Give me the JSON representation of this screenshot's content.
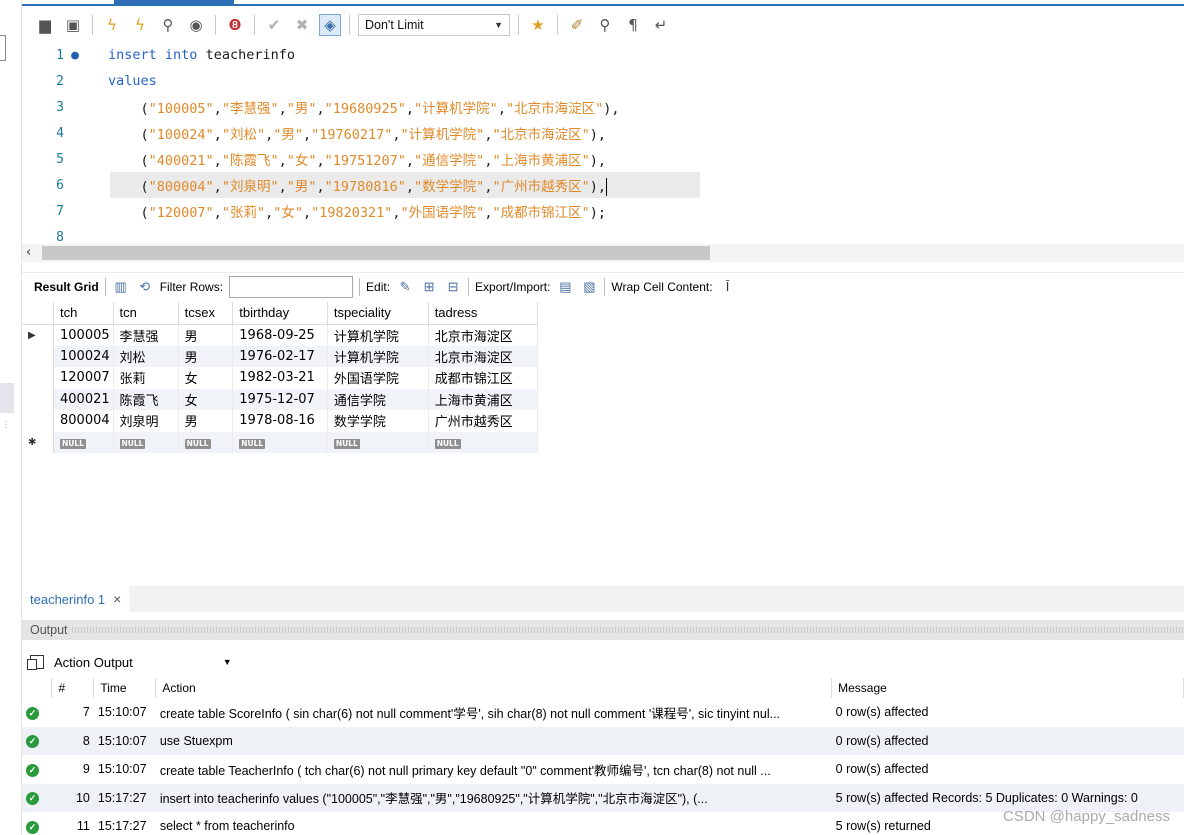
{
  "toolbar": {
    "limit_value": "Don't Limit"
  },
  "editor": {
    "lines": [
      {
        "num": "1",
        "parts": [
          [
            "kw",
            "insert"
          ],
          [
            "ident",
            " "
          ],
          [
            "kw",
            "into"
          ],
          [
            "ident",
            " teacherinfo"
          ]
        ]
      },
      {
        "num": "2",
        "parts": [
          [
            "kw",
            "values"
          ]
        ]
      },
      {
        "num": "3",
        "parts": [
          [
            "ident",
            "    ("
          ],
          [
            "str",
            "\"100005\""
          ],
          [
            "punc",
            ","
          ],
          [
            "str",
            "\"李慧强\""
          ],
          [
            "punc",
            ","
          ],
          [
            "str",
            "\"男\""
          ],
          [
            "punc",
            ","
          ],
          [
            "str",
            "\"19680925\""
          ],
          [
            "punc",
            ","
          ],
          [
            "str",
            "\"计算机学院\""
          ],
          [
            "punc",
            ","
          ],
          [
            "str",
            "\"北京市海淀区\""
          ],
          [
            "punc",
            "),"
          ]
        ]
      },
      {
        "num": "4",
        "parts": [
          [
            "ident",
            "    ("
          ],
          [
            "str",
            "\"100024\""
          ],
          [
            "punc",
            ","
          ],
          [
            "str",
            "\"刘松\""
          ],
          [
            "punc",
            ","
          ],
          [
            "str",
            "\"男\""
          ],
          [
            "punc",
            ","
          ],
          [
            "str",
            "\"19760217\""
          ],
          [
            "punc",
            ","
          ],
          [
            "str",
            "\"计算机学院\""
          ],
          [
            "punc",
            ","
          ],
          [
            "str",
            "\"北京市海淀区\""
          ],
          [
            "punc",
            "),"
          ]
        ]
      },
      {
        "num": "5",
        "parts": [
          [
            "ident",
            "    ("
          ],
          [
            "str",
            "\"400021\""
          ],
          [
            "punc",
            ","
          ],
          [
            "str",
            "\"陈霞飞\""
          ],
          [
            "punc",
            ","
          ],
          [
            "str",
            "\"女\""
          ],
          [
            "punc",
            ","
          ],
          [
            "str",
            "\"19751207\""
          ],
          [
            "punc",
            ","
          ],
          [
            "str",
            "\"通信学院\""
          ],
          [
            "punc",
            ","
          ],
          [
            "str",
            "\"上海市黄浦区\""
          ],
          [
            "punc",
            "),"
          ]
        ]
      },
      {
        "num": "6",
        "parts": [
          [
            "ident",
            "    ("
          ],
          [
            "str",
            "\"800004\""
          ],
          [
            "punc",
            ","
          ],
          [
            "str",
            "\"刘泉明\""
          ],
          [
            "punc",
            ","
          ],
          [
            "str",
            "\"男\""
          ],
          [
            "punc",
            ","
          ],
          [
            "str",
            "\"19780816\""
          ],
          [
            "punc",
            ","
          ],
          [
            "str",
            "\"数学学院\""
          ],
          [
            "punc",
            ","
          ],
          [
            "str",
            "\"广州市越秀区\""
          ],
          [
            "punc",
            "),"
          ]
        ]
      },
      {
        "num": "7",
        "parts": [
          [
            "ident",
            "    ("
          ],
          [
            "str",
            "\"120007\""
          ],
          [
            "punc",
            ","
          ],
          [
            "str",
            "\"张莉\""
          ],
          [
            "punc",
            ","
          ],
          [
            "str",
            "\"女\""
          ],
          [
            "punc",
            ","
          ],
          [
            "str",
            "\"19820321\""
          ],
          [
            "punc",
            ","
          ],
          [
            "str",
            "\"外国语学院\""
          ],
          [
            "punc",
            ","
          ],
          [
            "str",
            "\"成都市锦江区\""
          ],
          [
            "punc",
            ");"
          ]
        ]
      },
      {
        "num": "8",
        "parts": []
      }
    ]
  },
  "result_toolbar": {
    "result_grid": "Result Grid",
    "filter_rows": "Filter Rows:",
    "edit": "Edit:",
    "export_import": "Export/Import:",
    "wrap": "Wrap Cell Content:"
  },
  "grid": {
    "columns": [
      "tch",
      "tcn",
      "tcsex",
      "tbirthday",
      "tspeciality",
      "tadress"
    ],
    "rows": [
      [
        "100005",
        "李慧强",
        "男",
        "1968-09-25",
        "计算机学院",
        "北京市海淀区"
      ],
      [
        "100024",
        "刘松",
        "男",
        "1976-02-17",
        "计算机学院",
        "北京市海淀区"
      ],
      [
        "120007",
        "张莉",
        "女",
        "1982-03-21",
        "外国语学院",
        "成都市锦江区"
      ],
      [
        "400021",
        "陈霞飞",
        "女",
        "1975-12-07",
        "通信学院",
        "上海市黄浦区"
      ],
      [
        "800004",
        "刘泉明",
        "男",
        "1978-08-16",
        "数学学院",
        "广州市越秀区"
      ]
    ],
    "null_label": "NULL"
  },
  "lower_tabs": {
    "tab": "teacherinfo 1",
    "close": "×"
  },
  "output": {
    "title": "Output",
    "selector": "Action Output",
    "columns": [
      "#",
      "Time",
      "Action",
      "Message"
    ],
    "rows": [
      {
        "n": "7",
        "time": "15:10:07",
        "action": "create table ScoreInfo ( sin char(6) not null comment'学号', sih char(8) not null comment '课程号', sic tinyint nul...",
        "message": "0 row(s) affected"
      },
      {
        "n": "8",
        "time": "15:10:07",
        "action": "use Stuexpm",
        "message": "0 row(s) affected"
      },
      {
        "n": "9",
        "time": "15:10:07",
        "action": "create table TeacherInfo ( tch char(6)  not null primary key default \"0\" comment'教师编号', tcn char(8) not null ...",
        "message": "0 row(s) affected"
      },
      {
        "n": "10",
        "time": "15:17:27",
        "action": "insert into teacherinfo values      (\"100005\",\"李慧强\",\"男\",\"19680925\",\"计算机学院\",\"北京市海淀区\"),     (...",
        "message": "5 row(s) affected Records: 5  Duplicates: 0  Warnings: 0"
      },
      {
        "n": "11",
        "time": "15:17:27",
        "action": "select * from teacherinfo",
        "message": "5 row(s) returned"
      }
    ]
  },
  "watermark": "CSDN @happy_sadness"
}
